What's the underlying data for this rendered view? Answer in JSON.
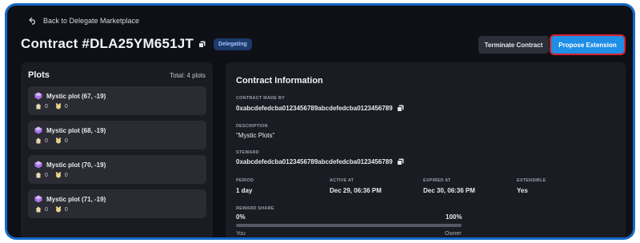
{
  "nav": {
    "back_label": "Back to Delegate Marketplace"
  },
  "contract": {
    "title": "Contract #DLA25YM651JT",
    "status": "Delegating"
  },
  "actions": {
    "terminate_label": "Terminate Contract",
    "propose_label": "Propose Extension"
  },
  "plots": {
    "title": "Plots",
    "total": "Total: 4 plots",
    "items": [
      {
        "name": "Mystic plot (67, -19)",
        "stat1": "0",
        "stat2": "0"
      },
      {
        "name": "Mystic plot (68, -19)",
        "stat1": "0",
        "stat2": "0"
      },
      {
        "name": "Mystic plot (70, -19)",
        "stat1": "0",
        "stat2": "0"
      },
      {
        "name": "Mystic plot (71, -19)",
        "stat1": "0",
        "stat2": "0"
      }
    ]
  },
  "info": {
    "title": "Contract Information",
    "made_by_label": "CONTRACT MADE BY",
    "made_by_value": "0xabcdefedcba0123456789abcdefedcba0123456789",
    "description_label": "DESCRIPTION",
    "description_value": "\"Mystic Plots\"",
    "steward_label": "STEWARD",
    "steward_value": "0xabcdefedcba0123456789abcdefedcba0123456789",
    "period_label": "PERIOD",
    "period_value": "1 day",
    "active_label": "ACTIVE AT",
    "active_value": "Dec 29, 06:36 PM",
    "expired_label": "EXPIRED AT",
    "expired_value": "Dec 30, 06:36 PM",
    "extensible_label": "EXTENSIBLE",
    "extensible_value": "Yes",
    "reward_label": "REWARD SHARE",
    "reward_left_pct": "0%",
    "reward_right_pct": "100%",
    "reward_left_name": "You",
    "reward_right_name": "Owner",
    "reward_fill_fraction": 0
  },
  "colors": {
    "frame": "#1569c7",
    "background": "#0f1016",
    "accent": "#1e8ee6",
    "highlight": "#d9212d",
    "badge": "#1d3a6b"
  },
  "icons": {
    "back": "arrow-back-icon",
    "copy": "copy-icon",
    "plot": "gem-icon",
    "stat1": "house-icon",
    "stat2": "creature-icon"
  }
}
